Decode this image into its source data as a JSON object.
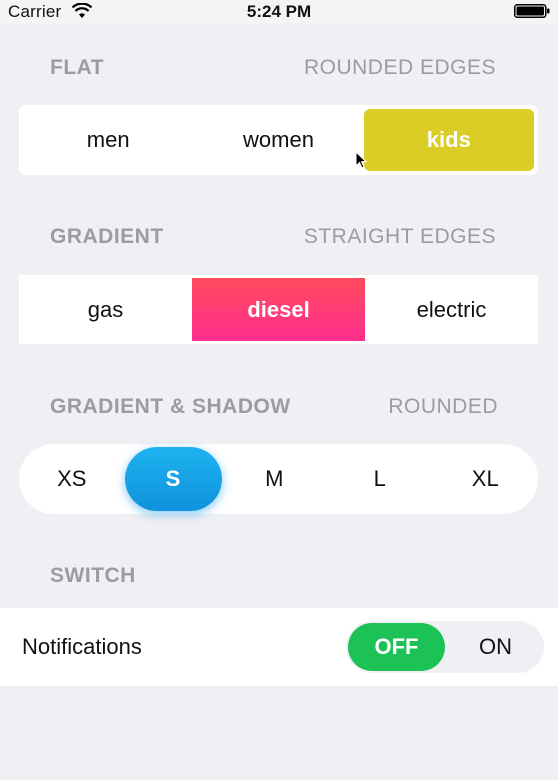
{
  "status_bar": {
    "carrier": "Carrier",
    "time": "5:24 PM",
    "wifi_icon": "wifi-icon",
    "battery_icon": "battery-icon"
  },
  "sections": {
    "flat": {
      "title": "FLAT",
      "subtitle": "ROUNDED EDGES",
      "options": [
        "men",
        "women",
        "kids"
      ],
      "selected": "kids",
      "accent": "#dbcd26"
    },
    "gradient": {
      "title": "GRADIENT",
      "subtitle": "STRAIGHT EDGES",
      "options": [
        "gas",
        "diesel",
        "electric"
      ],
      "selected": "diesel",
      "accent_from": "#ff4a5c",
      "accent_to": "#ff2f8f"
    },
    "gradient_shadow": {
      "title": "GRADIENT & SHADOW",
      "subtitle": "ROUNDED",
      "options": [
        "XS",
        "S",
        "M",
        "L",
        "XL"
      ],
      "selected": "S",
      "accent_from": "#1fb3f0",
      "accent_to": "#0e92dc"
    },
    "switch": {
      "title": "SWITCH",
      "row_label": "Notifications",
      "options": [
        "OFF",
        "ON"
      ],
      "selected": "OFF",
      "accent": "#1dc257"
    }
  },
  "colors": {
    "background": "#efeff4",
    "header_text": "#9b9ba0"
  },
  "cursor_icon": "mouse-pointer-icon"
}
